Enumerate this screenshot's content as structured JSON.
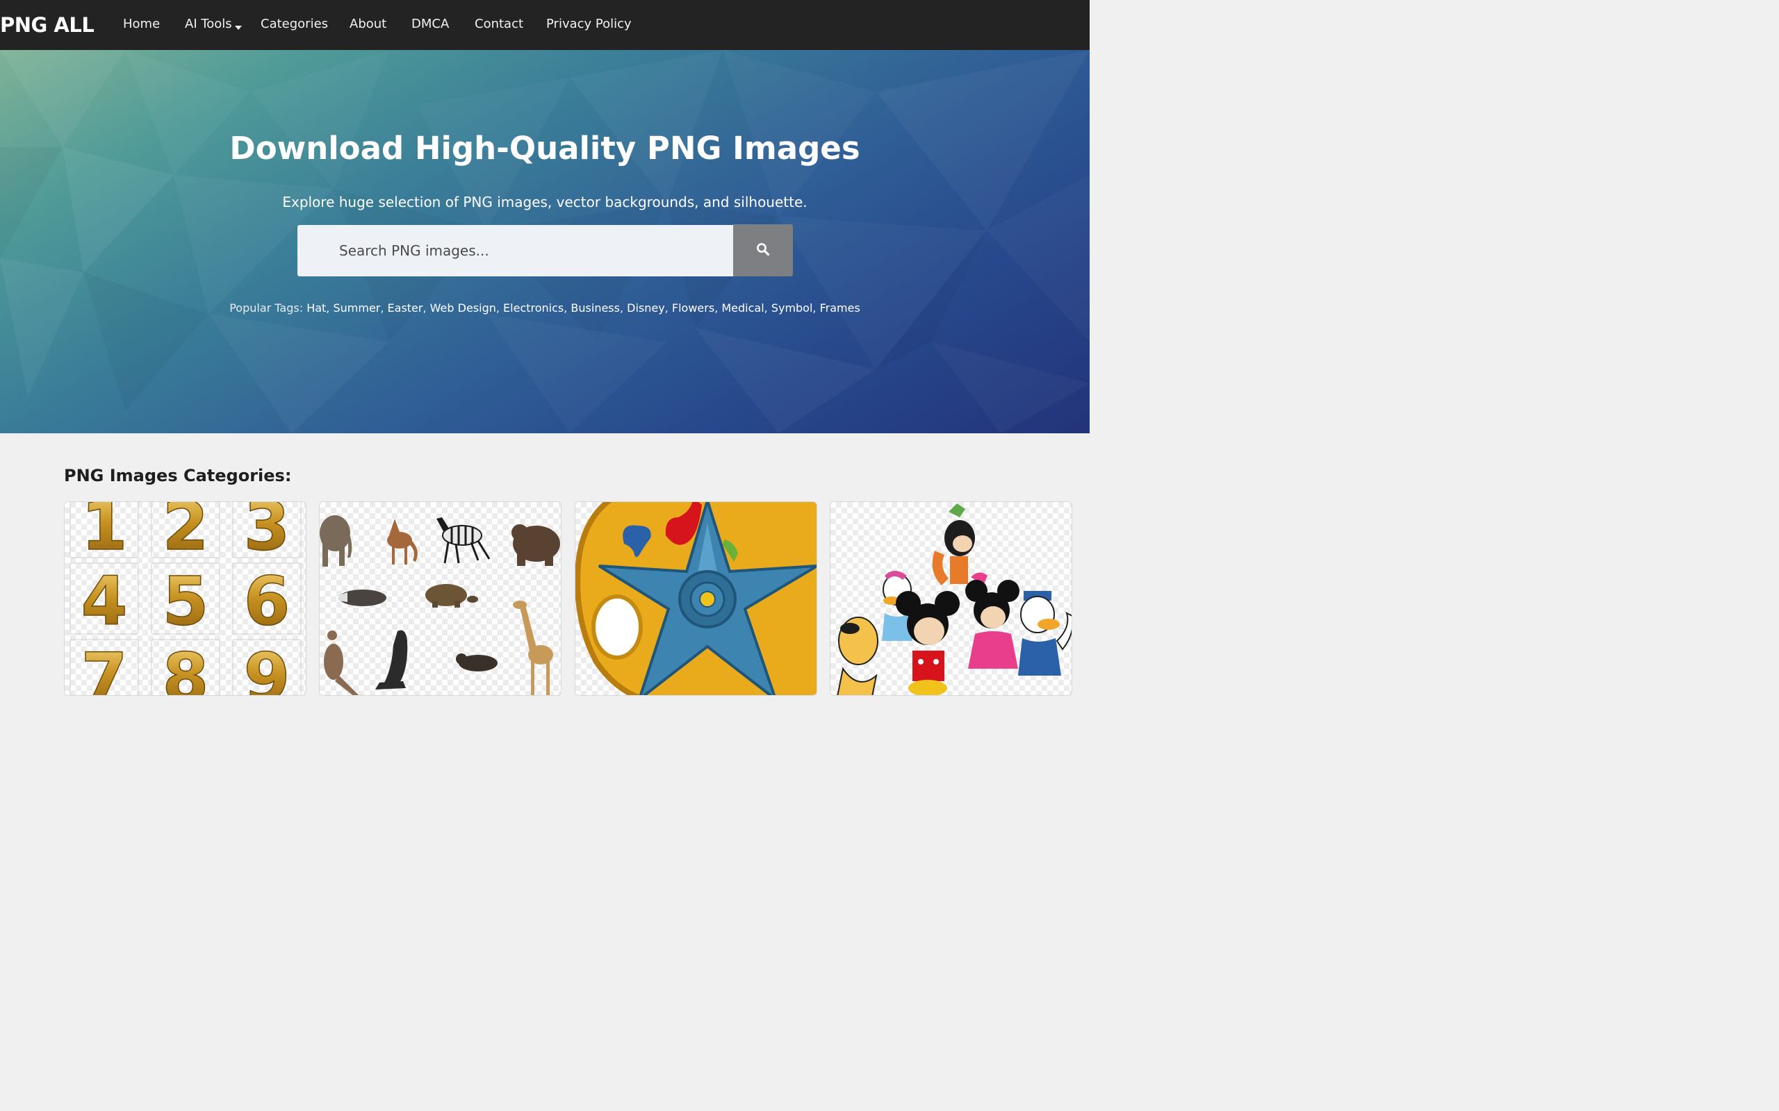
{
  "header": {
    "logo": "PNG ALL",
    "nav": [
      {
        "label": "Home"
      },
      {
        "label": "AI Tools",
        "has_dropdown": true
      },
      {
        "label": "Categories"
      },
      {
        "label": "About"
      },
      {
        "label": "DMCA"
      },
      {
        "label": "Contact"
      },
      {
        "label": "Privacy Policy"
      }
    ]
  },
  "hero": {
    "title": "Download High-Quality PNG Images",
    "subtitle": "Explore huge selection of PNG images, vector backgrounds, and silhouette.",
    "search": {
      "placeholder": "Search PNG images...",
      "value": "",
      "button_icon": "search-icon"
    },
    "popular_tags_label": "Popular Tags:",
    "popular_tags": [
      "Hat",
      "Summer",
      "Easter",
      "Web Design",
      "Electronics",
      "Business",
      "Disney",
      "Flowers",
      "Medical",
      "Symbol",
      "Frames"
    ]
  },
  "categories": {
    "heading": "PNG Images Categories:",
    "cards": [
      {
        "digits": [
          "1",
          "2",
          "3",
          "4",
          "5",
          "6",
          "7",
          "8",
          "9"
        ]
      },
      {},
      {},
      {}
    ]
  },
  "colors": {
    "navbar_bg": "#232323",
    "hero_gradient_start": "#7fb296",
    "hero_gradient_end": "#23337a",
    "search_button_bg": "#7d7f82",
    "page_bg": "#f0f0f0"
  }
}
